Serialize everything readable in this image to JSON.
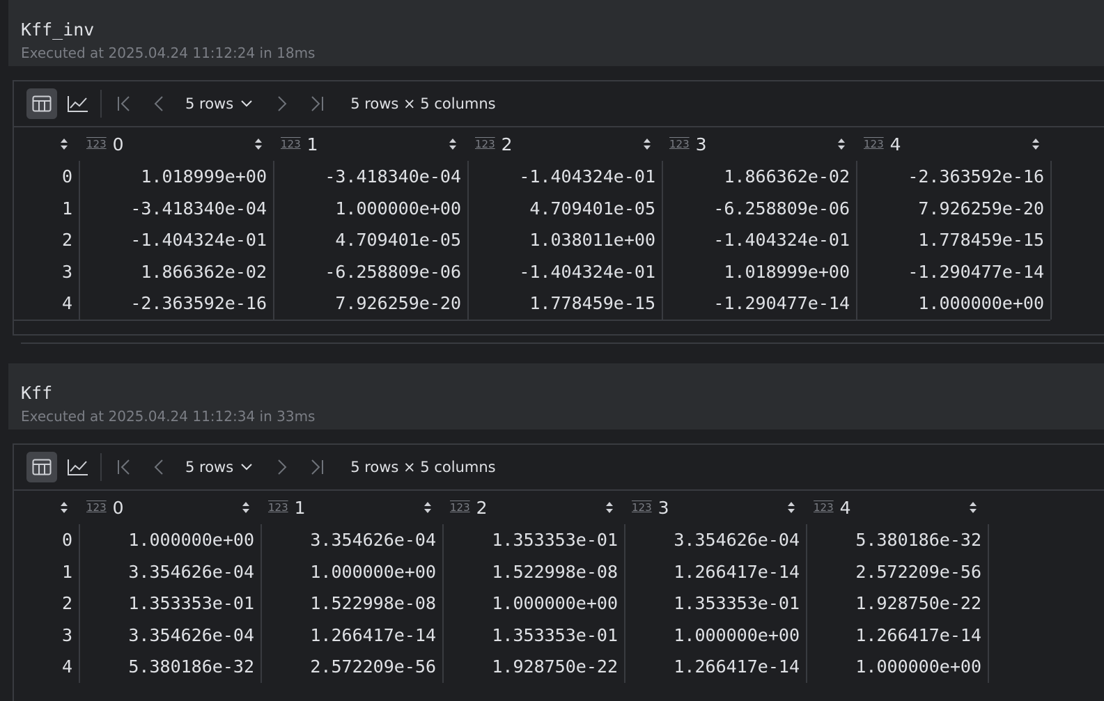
{
  "outputs": [
    {
      "title": "Kff_inv",
      "meta": "Executed at 2025.04.24 11:12:24 in 18ms",
      "toolbar": {
        "rows_label": "5 rows",
        "summary": "5 rows × 5 columns"
      },
      "type_badge": "123",
      "columns": [
        "0",
        "1",
        "2",
        "3",
        "4"
      ],
      "rows": [
        {
          "index": "0",
          "cells": [
            "1.018999e+00",
            "-3.418340e-04",
            "-1.404324e-01",
            "1.866362e-02",
            "-2.363592e-16"
          ]
        },
        {
          "index": "1",
          "cells": [
            "-3.418340e-04",
            "1.000000e+00",
            "4.709401e-05",
            "-6.258809e-06",
            "7.926259e-20"
          ]
        },
        {
          "index": "2",
          "cells": [
            "-1.404324e-01",
            "4.709401e-05",
            "1.038011e+00",
            "-1.404324e-01",
            "1.778459e-15"
          ]
        },
        {
          "index": "3",
          "cells": [
            "1.866362e-02",
            "-6.258809e-06",
            "-1.404324e-01",
            "1.018999e+00",
            "-1.290477e-14"
          ]
        },
        {
          "index": "4",
          "cells": [
            "-2.363592e-16",
            "7.926259e-20",
            "1.778459e-15",
            "-1.290477e-14",
            "1.000000e+00"
          ]
        }
      ]
    },
    {
      "title": "Kff",
      "meta": "Executed at 2025.04.24 11:12:34 in 33ms",
      "toolbar": {
        "rows_label": "5 rows",
        "summary": "5 rows × 5 columns"
      },
      "type_badge": "123",
      "columns": [
        "0",
        "1",
        "2",
        "3",
        "4"
      ],
      "rows": [
        {
          "index": "0",
          "cells": [
            "1.000000e+00",
            "3.354626e-04",
            "1.353353e-01",
            "3.354626e-04",
            "5.380186e-32"
          ]
        },
        {
          "index": "1",
          "cells": [
            "3.354626e-04",
            "1.000000e+00",
            "1.522998e-08",
            "1.266417e-14",
            "2.572209e-56"
          ]
        },
        {
          "index": "2",
          "cells": [
            "1.353353e-01",
            "1.522998e-08",
            "1.000000e+00",
            "1.353353e-01",
            "1.928750e-22"
          ]
        },
        {
          "index": "3",
          "cells": [
            "3.354626e-04",
            "1.266417e-14",
            "1.353353e-01",
            "1.000000e+00",
            "1.266417e-14"
          ]
        },
        {
          "index": "4",
          "cells": [
            "5.380186e-32",
            "2.572209e-56",
            "1.928750e-22",
            "1.266417e-14",
            "1.000000e+00"
          ]
        }
      ]
    }
  ]
}
